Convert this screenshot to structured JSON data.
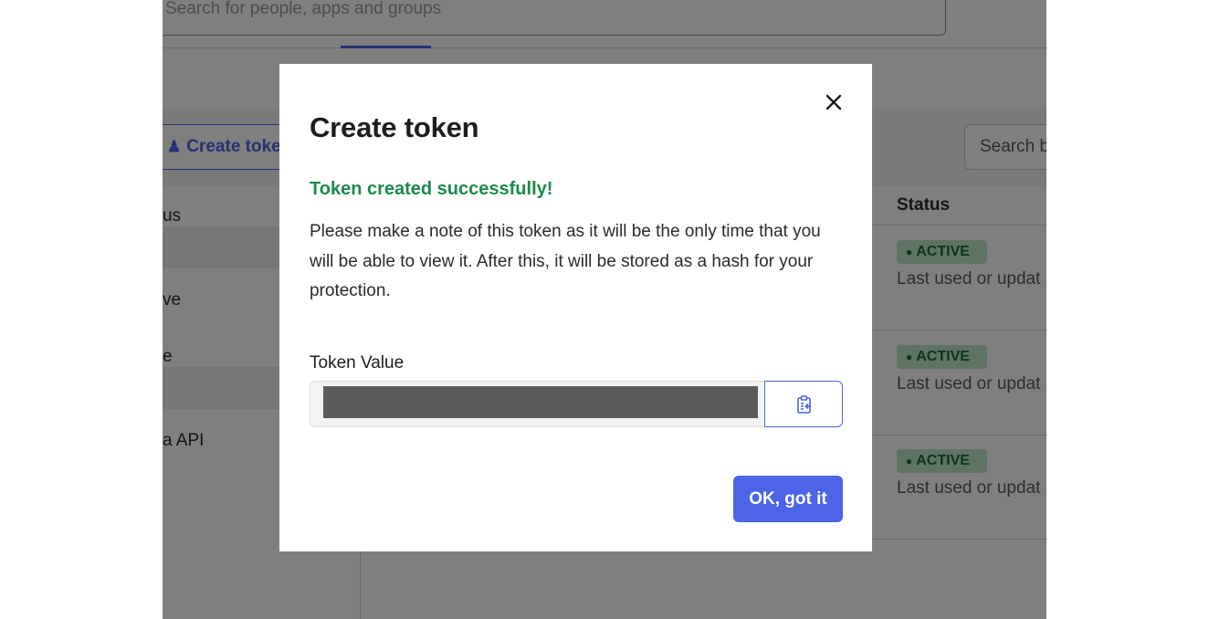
{
  "background": {
    "top_search_placeholder": "Search for people, apps and groups",
    "create_token_button": "Create toke",
    "panel_search_placeholder": "Search b",
    "sidebar_items": [
      "us",
      "",
      "ve",
      "e",
      "",
      "a API"
    ],
    "table": {
      "status_header": "Status",
      "rows": [
        {
          "status": "ACTIVE",
          "last_used": "Last used or updat"
        },
        {
          "status": "ACTIVE",
          "last_used": "Last used or updat"
        },
        {
          "status": "ACTIVE",
          "last_used": "Last used or updat"
        }
      ]
    }
  },
  "modal": {
    "title": "Create token",
    "success_message": "Token created successfully!",
    "note": "Please make a note of this token as it will be the only time that you will be able to view it. After this, it will be stored as a hash for your protection.",
    "token_label": "Token Value",
    "token_value": "",
    "copy_icon": "clipboard-copy-icon",
    "close_icon": "close-icon",
    "ok_button": "OK, got it"
  },
  "colors": {
    "accent": "#4c64e6",
    "success": "#1b8a4b",
    "badge_bg": "#bfe7cb",
    "badge_text": "#1b6b39",
    "overlay": "rgba(0,0,0,0.5)"
  }
}
